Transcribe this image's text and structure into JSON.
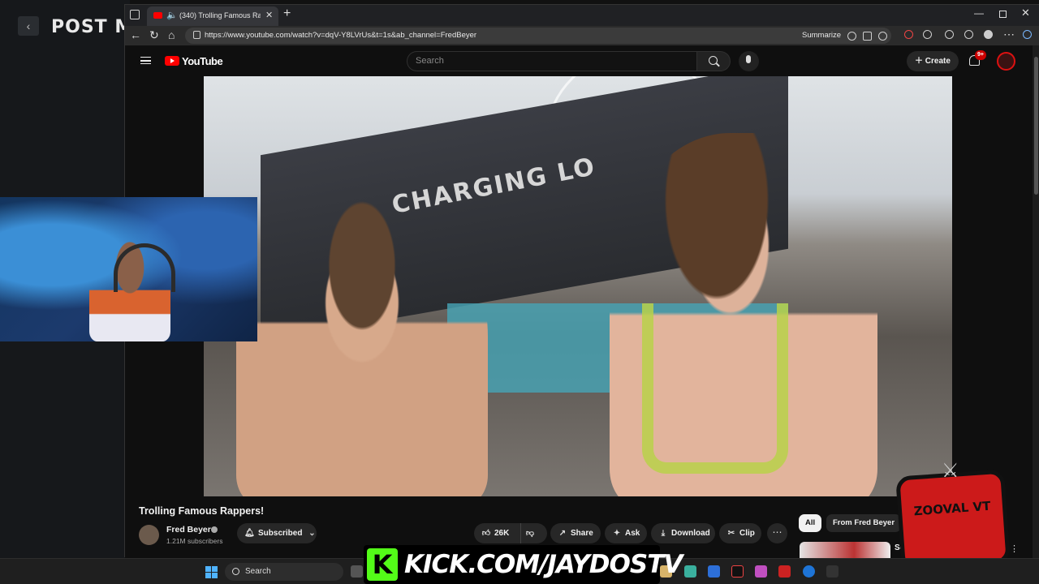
{
  "background_app": {
    "title": "POST M",
    "back_glyph": "‹"
  },
  "browser": {
    "tab": {
      "title": "(340) Trolling Famous Rapp...",
      "favicon": "youtube-icon"
    },
    "new_tab_glyph": "+",
    "window_controls": {
      "minimize": "—",
      "close": "✕"
    },
    "url": "https://www.youtube.com/watch?v=dqV-Y8LVrUs&t=1s&ab_channel=FredBeyer",
    "summarize_label": "Summarize",
    "nav": {
      "back": "←",
      "reload": "↻",
      "home": "⌂"
    }
  },
  "youtube": {
    "logo_text": "YouTube",
    "search_placeholder": "Search",
    "create_label": "Create",
    "notification_count": "9+",
    "video": {
      "overlay_text": "CHARGING LO",
      "title": "Trolling Famous Rappers!",
      "channel": "Fred Beyer",
      "subscribers": "1.21M subscribers",
      "subscribed_label": "Subscribed",
      "likes": "26K",
      "share_label": "Share",
      "ask_label": "Ask",
      "download_label": "Download",
      "clip_label": "Clip",
      "more_glyph": "⋯"
    },
    "chips": [
      "All",
      "From Fred Beyer"
    ],
    "sidebar_item_title": "Se"
  },
  "overlays": {
    "kick_logo_letter": "K",
    "kick_text": "KICK.COM/JAYDOSTV",
    "streamer_logo": "ZOOVAL VT"
  },
  "taskbar": {
    "search_label": "Search"
  }
}
